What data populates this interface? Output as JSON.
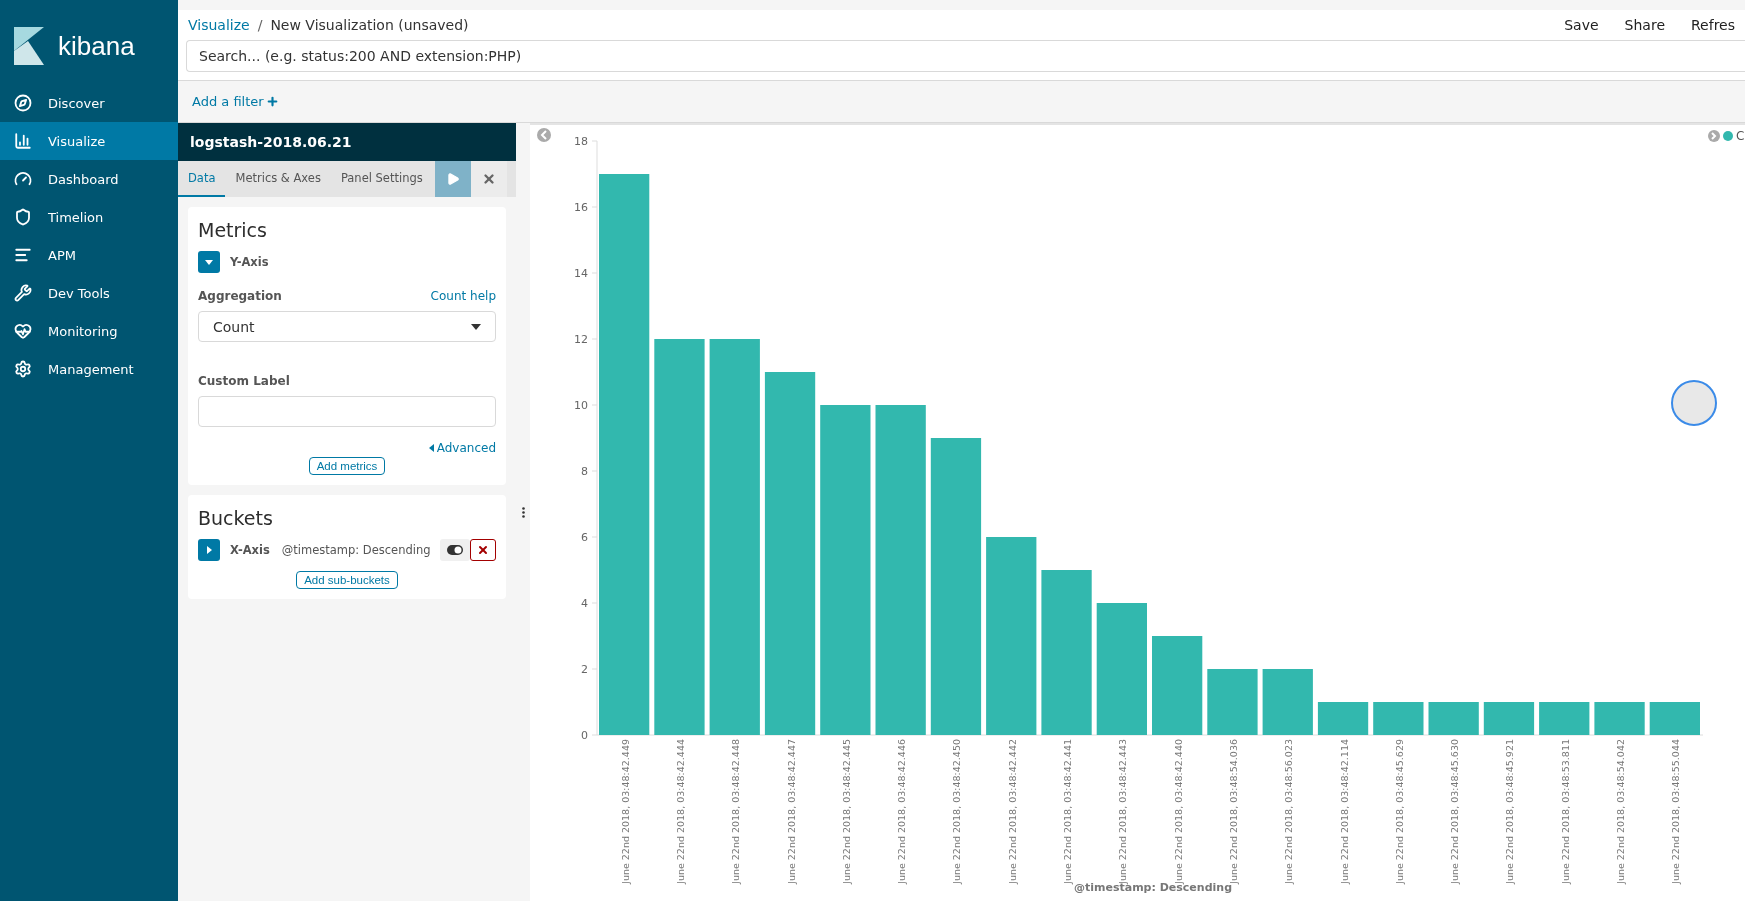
{
  "sidebar": {
    "logo_text": "kibana",
    "items": [
      {
        "label": "Discover",
        "selected": false
      },
      {
        "label": "Visualize",
        "selected": true
      },
      {
        "label": "Dashboard",
        "selected": false
      },
      {
        "label": "Timelion",
        "selected": false
      },
      {
        "label": "APM",
        "selected": false
      },
      {
        "label": "Dev Tools",
        "selected": false
      },
      {
        "label": "Monitoring",
        "selected": false
      },
      {
        "label": "Management",
        "selected": false
      }
    ]
  },
  "header": {
    "breadcrumbs": [
      {
        "label": "Visualize",
        "link": true
      },
      {
        "label": "New Visualization (unsaved)",
        "link": false
      }
    ],
    "separator": "/",
    "actions": [
      "Save",
      "Share",
      "Refres"
    ]
  },
  "search": {
    "placeholder": "Search... (e.g. status:200 AND extension:PHP)"
  },
  "filter_bar": {
    "add_filter": "Add a filter"
  },
  "editor": {
    "index_pattern": "logstash-2018.06.21",
    "tabs": [
      {
        "label": "Data",
        "selected": true
      },
      {
        "label": "Metrics & Axes",
        "selected": false
      },
      {
        "label": "Panel Settings",
        "selected": false
      }
    ],
    "metrics": {
      "title": "Metrics",
      "agg": {
        "label": "Y-Axis",
        "expanded": true
      },
      "aggregation_label": "Aggregation",
      "help_link": "Count help",
      "aggregation_value": "Count",
      "custom_label": "Custom Label",
      "advanced": "Advanced",
      "add_button": "Add metrics"
    },
    "buckets": {
      "title": "Buckets",
      "agg": {
        "label": "X-Axis",
        "expanded": false,
        "description": "@timestamp: Descending",
        "enabled": true
      },
      "add_button": "Add sub-buckets"
    }
  },
  "chart": {
    "chart_data": {
      "type": "bar",
      "xlabel": "@timestamp: Descending",
      "ylim": [
        0,
        18
      ],
      "yticks": [
        0,
        2,
        4,
        6,
        8,
        10,
        12,
        14,
        16,
        18
      ],
      "categories": [
        "June 22nd 2018, 03:48:42.449",
        "June 22nd 2018, 03:48:42.444",
        "June 22nd 2018, 03:48:42.448",
        "June 22nd 2018, 03:48:42.447",
        "June 22nd 2018, 03:48:42.445",
        "June 22nd 2018, 03:48:42.446",
        "June 22nd 2018, 03:48:42.450",
        "June 22nd 2018, 03:48:42.442",
        "June 22nd 2018, 03:48:42.441",
        "June 22nd 2018, 03:48:42.443",
        "June 22nd 2018, 03:48:42.440",
        "June 22nd 2018, 03:48:54.036",
        "June 22nd 2018, 03:48:56.023",
        "June 22nd 2018, 03:48:42.114",
        "June 22nd 2018, 03:48:45.629",
        "June 22nd 2018, 03:48:45.630",
        "June 22nd 2018, 03:48:45.921",
        "June 22nd 2018, 03:48:53.811",
        "June 22nd 2018, 03:48:54.042",
        "June 22nd 2018, 03:48:55.044"
      ],
      "series": [
        {
          "name": "C",
          "color": "#32b8ae",
          "values": [
            17,
            12,
            12,
            11,
            10,
            10,
            9,
            6,
            5,
            4,
            3,
            2,
            2,
            1,
            1,
            1,
            1,
            1,
            1,
            1
          ]
        }
      ]
    }
  }
}
